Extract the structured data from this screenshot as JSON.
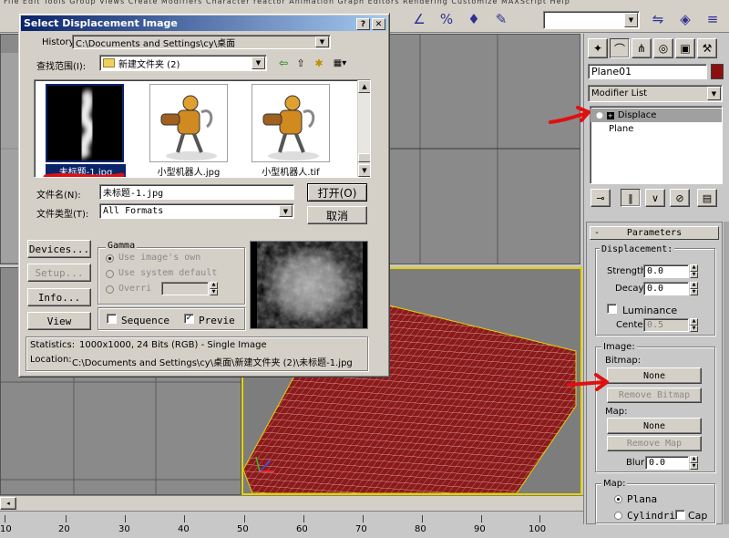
{
  "menubar": {
    "text": "File  Edit  Tools  Group  Views  Create  Modifiers  Character  reactor  Animation  Graph Editors  Rendering  Customize  MAXScript  Help"
  },
  "dialog": {
    "title": "Select Displacement Image",
    "history_label": "History:",
    "history_value": "C:\\Documents and Settings\\cy\\桌面",
    "lookin_label": "查找范围(I):",
    "lookin_value": "新建文件夹 (2)",
    "files": [
      {
        "name": "未标题-1.jpg"
      },
      {
        "name": "小型机器人.jpg"
      },
      {
        "name": "小型机器人.tif"
      }
    ],
    "filename_label": "文件名(N):",
    "filename_value": "未标题-1.jpg",
    "filetype_label": "文件类型(T):",
    "filetype_value": "All Formats",
    "open_label": "打开(O)",
    "cancel_label": "取消",
    "devices_label": "Devices...",
    "setup_label": "Setup...",
    "info_label": "Info...",
    "view_label": "View",
    "gamma_title": "Gamma",
    "gamma_own": "Use image's own",
    "gamma_system": "Use system default",
    "gamma_override": "Overri",
    "sequence_label": "Sequence",
    "preview_label": "Previe",
    "statistics_label": "Statistics:",
    "statistics_value": "1000x1000, 24 Bits (RGB) - Single Image",
    "location_label": "Location:",
    "location_value": "C:\\Documents and Settings\\cy\\桌面\\新建文件夹 (2)\\未标题-1.jpg"
  },
  "cmd": {
    "object_name": "Plane01",
    "object_color": "#8b1010",
    "modifier_list": "Modifier List",
    "stack": [
      "Displace",
      "Plane"
    ],
    "parameters_title": "Parameters",
    "displacement_title": "Displacement:",
    "strength_label": "Strength:",
    "strength_value": "0.0",
    "decay_label": "Decay:",
    "decay_value": "0.0",
    "luminance_label": "Luminance",
    "center_label": "Center:",
    "center_value": "0.5",
    "image_title": "Image:",
    "bitmap_label": "Bitmap:",
    "bitmap_button": "None",
    "remove_bitmap": "Remove Bitmap",
    "map_label": "Map:",
    "map_button": "None",
    "remove_map": "Remove Map",
    "blur_label": "Blur:",
    "blur_value": "0.0",
    "map_title": "Map:",
    "planar_label": "Plana",
    "cylindrical_label": "Cylindri",
    "cap_label": "Cap"
  },
  "timeline": {
    "ticks": [
      "10",
      "20",
      "30",
      "40",
      "50",
      "60",
      "70",
      "80",
      "90",
      "100"
    ]
  },
  "colors": {
    "annotation_red": "#e01010",
    "viewport_active": "#e6d200",
    "plane_red": "#8b1a1a"
  }
}
